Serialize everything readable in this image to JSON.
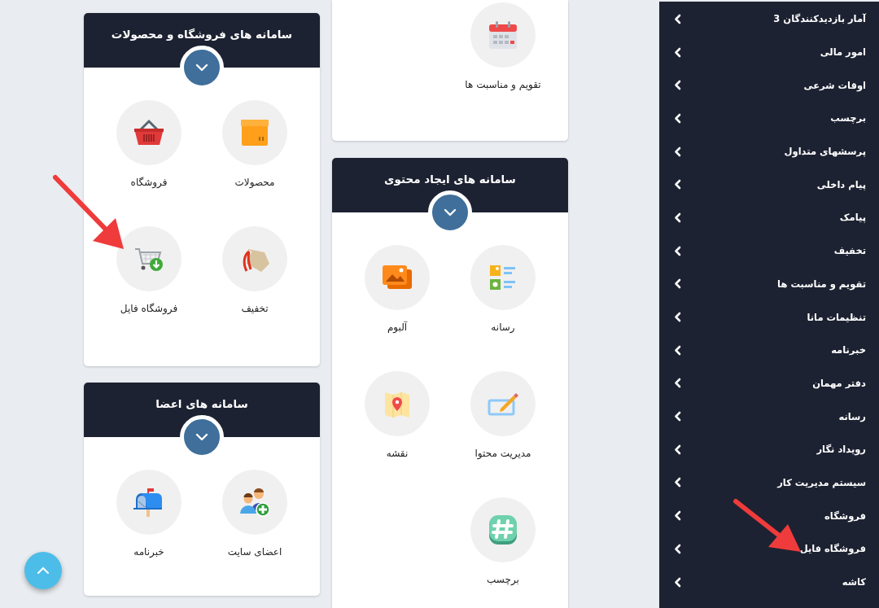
{
  "columns": [
    {
      "cards": [
        {
          "title": "سامانه های فروشگاه و محصولات",
          "items": [
            {
              "label": "محصولات"
            },
            {
              "label": "فروشگاه"
            },
            {
              "label": "تخفیف"
            },
            {
              "label": "فروشگاه فایل"
            }
          ]
        },
        {
          "title": "سامانه های اعضا",
          "items": [
            {
              "label": "اعضای سایت"
            },
            {
              "label": "خبرنامه"
            }
          ]
        }
      ]
    },
    {
      "cards": [
        {
          "items": [
            {
              "label": "تقویم و مناسبت ها"
            }
          ]
        },
        {
          "title": "سامانه های ایجاد محتوی",
          "items": [
            {
              "label": "رسانه"
            },
            {
              "label": "آلبوم"
            },
            {
              "label": "مدیریت محتوا"
            },
            {
              "label": "نقشه"
            },
            {
              "label": "برچسب"
            }
          ]
        }
      ]
    }
  ],
  "sidebar": {
    "items": [
      "آمار بازدیدکنندگان 3",
      "امور مالی",
      "اوقات شرعی",
      "برچسب",
      "پرسشهای متداول",
      "پیام داخلی",
      "پیامک",
      "تخفیف",
      "تقویم و مناسبت ها",
      "تنظیمات مانا",
      "خبرنامه",
      "دفتر مهمان",
      "رسانه",
      "رویداد نگار",
      "سیستم مدیریت کار",
      "فروشگاه",
      "فروشگاه فایل",
      "کاشه"
    ]
  }
}
